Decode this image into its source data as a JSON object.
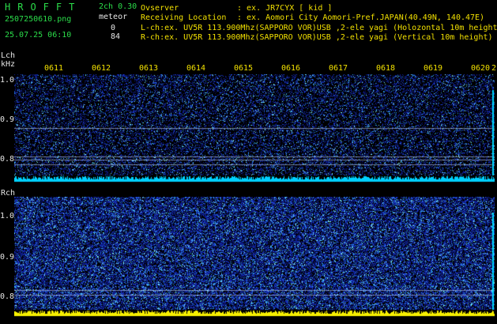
{
  "header": {
    "app_title": "HROFFT",
    "filename": "2507250610.png",
    "datetime": "25.07.25 06:10",
    "mode": "2ch 0.30",
    "meteor_label": "meteor",
    "count_l": "0",
    "count_r": "84"
  },
  "observer": {
    "labels": "Ovserver\nReceiving Location\nL-ch:ex. UV5R 113.900Mhz(SAPPORO VOR)USB ,2-ele yagi (Holozontal 10m height)\nR-ch:ex. UV5R 113.900Mhz(SAPPORO VOR)USB ,2-ele yagi (Vertical 10m height)",
    "values": ": ex. JR7CYX [ kid ]\n: ex. Aomori City Aomori-Pref.JAPAN(40.49N, 140.47E)"
  },
  "axes": {
    "lch_label": "Lch",
    "khz_label": "kHz",
    "rch_label": "Rch",
    "y_ticks": [
      "1.0",
      "0.9",
      "0.8"
    ],
    "x_ticks": [
      "0611",
      "0612",
      "0613",
      "0614",
      "0615",
      "0616",
      "0617",
      "0618",
      "0619",
      "0620",
      "2"
    ]
  },
  "colors": {
    "background": "#000000",
    "text_green": "#2bdc4a",
    "text_yellow": "#f2e000",
    "noise_low": "#0a0a5a",
    "noise_high": "#00e8ff",
    "baseline_l": "#00d0ff",
    "baseline_r": "#f7f000"
  }
}
